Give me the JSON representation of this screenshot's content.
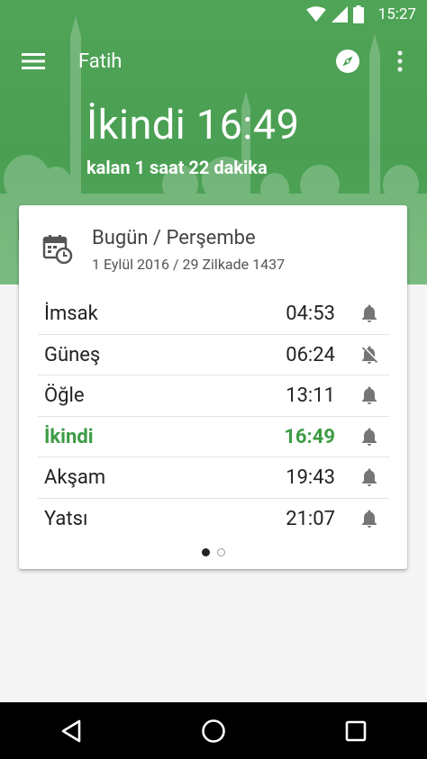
{
  "status_bar": {
    "time": "15:27",
    "icons": [
      "wifi-icon",
      "signal-icon",
      "battery-icon"
    ]
  },
  "app_bar": {
    "title": "Fatih",
    "icons": [
      "menu-icon",
      "compass-icon",
      "more-vert-icon"
    ]
  },
  "hero": {
    "current_prayer": "İkindi 16:49",
    "remaining": "kalan 1 saat 22 dakika"
  },
  "card": {
    "day_title": "Bugün / Perşembe",
    "date_line": "1 Eylül 2016 / 29 Zilkade 1437",
    "prayers": [
      {
        "name": "İmsak",
        "time": "04:53",
        "alarm": "on",
        "active": false
      },
      {
        "name": "Güneş",
        "time": "06:24",
        "alarm": "off",
        "active": false
      },
      {
        "name": "Öğle",
        "time": "13:11",
        "alarm": "on",
        "active": false
      },
      {
        "name": "İkindi",
        "time": "16:49",
        "alarm": "on",
        "active": true
      },
      {
        "name": "Akşam",
        "time": "19:43",
        "alarm": "on",
        "active": false
      },
      {
        "name": "Yatsı",
        "time": "21:07",
        "alarm": "on",
        "active": false
      }
    ],
    "page_indicator": {
      "count": 2,
      "current": 1
    }
  },
  "colors": {
    "primary": "#4a9f53",
    "accent_text": "#3e9c46",
    "nav_bar": "#000000"
  },
  "nav_bar": {
    "icons": [
      "back-icon",
      "home-icon",
      "recents-icon"
    ]
  }
}
